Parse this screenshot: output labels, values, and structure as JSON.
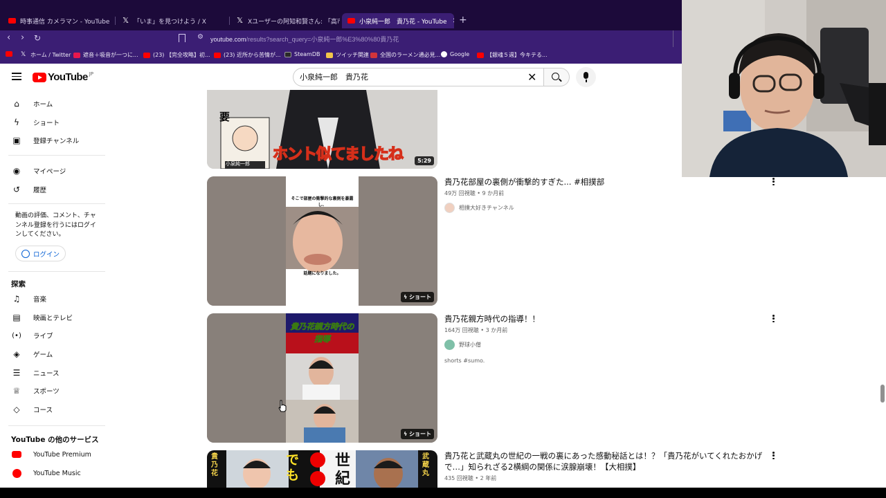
{
  "browser": {
    "tabs": [
      {
        "title": "時事通信 カメラマン - YouTube",
        "favicon": "youtube-favicon",
        "active": false
      },
      {
        "title": "「いま」を見つけよう / X",
        "favicon": "x-favicon",
        "active": false
      },
      {
        "title": "Xユーザーの阿知和賢さん: 「高市新総裁",
        "favicon": "x-favicon",
        "active": false
      },
      {
        "title": "小泉純一郎　貴乃花 - YouTube",
        "favicon": "youtube-favicon",
        "active": true
      }
    ],
    "url_host": "youtube.com",
    "url_path": "/results?search_query=小泉純一郎%E3%80%80貴乃花",
    "bookmarks": [
      {
        "label": "ホーム / Twitter",
        "icon": "x-icon",
        "color": "#000000"
      },
      {
        "label": "遮音＋吸音が一つに...",
        "icon": "shop-icon",
        "color": "#e8174d"
      },
      {
        "label": "(23) 【完全攻略】初...",
        "icon": "youtube-icon",
        "color": "#ff0000"
      },
      {
        "label": "(23) 近所から苦情が...",
        "icon": "youtube-icon",
        "color": "#ff0000"
      },
      {
        "label": "SteamDB",
        "icon": "steamdb-icon",
        "color": "#2a2a2a"
      },
      {
        "label": "ツイッチ関連",
        "icon": "folder-icon",
        "color": "#f3c64a"
      },
      {
        "label": "全国のラーメン通必見...",
        "icon": "ramen-icon",
        "color": "#d1343a"
      },
      {
        "label": "Google",
        "icon": "google-icon",
        "color": "#ffffff"
      },
      {
        "label": "【銀魂５週】今キテる...",
        "icon": "youtube-icon",
        "color": "#ff0000"
      }
    ]
  },
  "youtube": {
    "logo_text": "YouTube",
    "logo_region": "JP",
    "search_value": "小泉純一郎　貴乃花",
    "sidebar": {
      "main": [
        {
          "label": "ホーム",
          "icon": "home-icon"
        },
        {
          "label": "ショート",
          "icon": "shorts-icon"
        },
        {
          "label": "登録チャンネル",
          "icon": "subscriptions-icon"
        }
      ],
      "you": [
        {
          "label": "マイページ",
          "icon": "user-icon"
        },
        {
          "label": "履歴",
          "icon": "history-icon"
        }
      ],
      "signin_prompt": "動画の評価、コメント、チャンネル登録を行うにはログインしてください。",
      "login_label": "ログイン",
      "explore_heading": "探索",
      "explore": [
        {
          "label": "音楽",
          "icon": "music-icon"
        },
        {
          "label": "映画とテレビ",
          "icon": "movie-icon"
        },
        {
          "label": "ライブ",
          "icon": "live-icon"
        },
        {
          "label": "ゲーム",
          "icon": "gaming-icon"
        },
        {
          "label": "ニュース",
          "icon": "news-icon"
        },
        {
          "label": "スポーツ",
          "icon": "trophy-icon"
        },
        {
          "label": "コース",
          "icon": "course-icon"
        }
      ],
      "more_heading": "YouTube の他のサービス",
      "more": [
        {
          "label": "YouTube Premium",
          "icon": "youtube-premium-icon"
        },
        {
          "label": "YouTube Music",
          "icon": "youtube-music-icon"
        }
      ]
    },
    "results": [
      {
        "thumb_caption": "ホント似てましたね",
        "thumb_name_tag": "小泉純一郎",
        "duration": "5:29"
      },
      {
        "title": "貴乃花部屋の裏側が衝撃的すぎた... #相撲部",
        "views": "49万 回視聴",
        "age": "9 か月前",
        "channel": "相撲大好きチャンネル",
        "badge": "ショート",
        "thumb_text_top": "そこで部屋の衝撃的な裏側を暴露し、",
        "thumb_text_bottom": "話題になりました。"
      },
      {
        "title": "貴乃花親方時代の指導！！",
        "views": "164万 回視聴",
        "age": "3 か月前",
        "channel": "野球小僧",
        "description": "shorts #sumo.",
        "badge": "ショート",
        "thumb_caption": "貴乃花親方時代の指導"
      },
      {
        "title": "貴乃花と武蔵丸の世紀の一戦の裏にあった感動秘話とは！？「貴乃花がいてくれたおかげで…」知られざる2横綱の関係に涙腺崩壊！【大相撲】",
        "views": "435 回視聴",
        "age": "2 年前",
        "thumb_left_name": "貴乃花",
        "thumb_right_name": "武蔵丸",
        "thumb_center_text": "でも",
        "thumb_big_text": "世紀"
      }
    ]
  }
}
